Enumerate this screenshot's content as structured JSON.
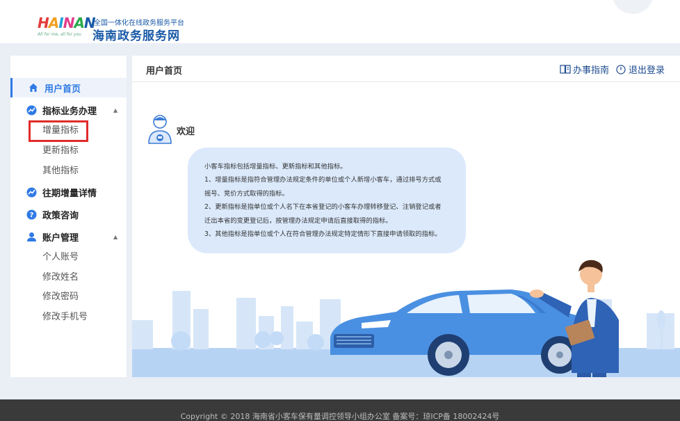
{
  "header": {
    "logo_text": "HAINAN",
    "logo_tagline": "All for me, all for you",
    "site_subtitle": "全国一体化在线政务服务平台",
    "site_title": "海南政务服务网"
  },
  "sidebar": {
    "items": [
      {
        "label": "用户首页",
        "icon": "home-icon",
        "active": true
      },
      {
        "label": "指标业务办理",
        "icon": "chart-icon",
        "expanded": true,
        "children": [
          "增量指标",
          "更新指标",
          "其他指标"
        ]
      },
      {
        "label": "往期增量详情",
        "icon": "chart-icon"
      },
      {
        "label": "政策咨询",
        "icon": "question-icon"
      },
      {
        "label": "账户管理",
        "icon": "user-icon",
        "expanded": true,
        "children": [
          "个人账号",
          "修改姓名",
          "修改密码",
          "修改手机号"
        ]
      }
    ]
  },
  "main": {
    "title": "用户首页",
    "guide_link": "办事指南",
    "logout_link": "退出登录",
    "welcome": "欢迎",
    "intro_lines": [
      "小客车指标包括增量指标、更新指标和其他指标。",
      "1、增量指标是指符合管理办法规定条件的单位或个人新增小客车，通过排号方式或",
      "摇号、竞价方式取得的指标。",
      "2、更新指标是指单位或个人名下在本省登记的小客车办理转移登记、注销登记或者",
      "迁出本省的变更登记后，按管理办法规定申请后直接取得的指标。",
      "3、其他指标是指单位或个人在符合管理办法规定特定情形下直接申请领取的指标。"
    ]
  },
  "footer": {
    "text": "Copyright © 2018   海南省小客车保有量调控领导小组办公室    备案号：琼ICP备 18002424号"
  },
  "colors": {
    "accent": "#2f7ae5",
    "brand": "#1a5aa8",
    "highlight": "#e02b2b",
    "footer_bg": "#3a3a3a"
  }
}
